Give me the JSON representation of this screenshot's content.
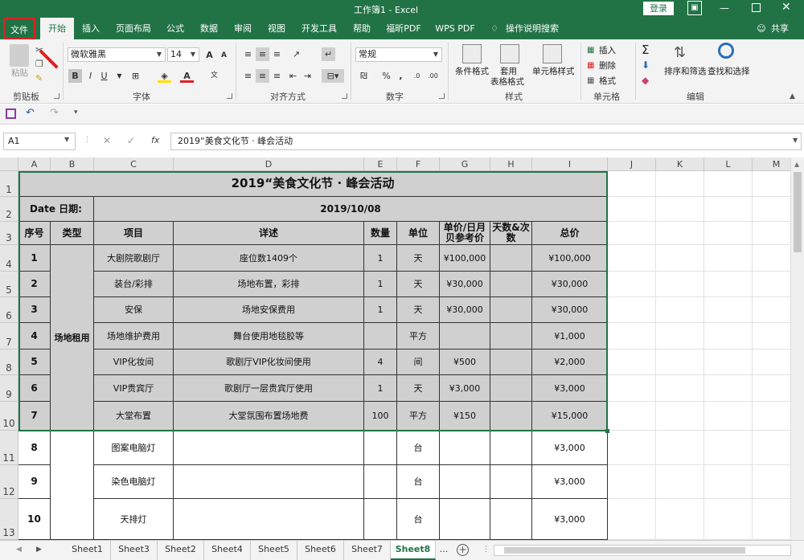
{
  "window": {
    "title": "工作簿1 - Excel",
    "login": "登录"
  },
  "tabs": [
    "文件",
    "开始",
    "插入",
    "页面布局",
    "公式",
    "数据",
    "审阅",
    "视图",
    "开发工具",
    "帮助",
    "福昕PDF",
    "WPS PDF",
    "操作说明搜索"
  ],
  "share": "共享",
  "ribbon": {
    "clipboard": {
      "label": "剪贴板",
      "paste": "粘贴"
    },
    "font": {
      "label": "字体",
      "name": "微软雅黑",
      "size": "14",
      "grow": "A",
      "shrink": "A",
      "bold": "B",
      "italic": "I",
      "underline": "U"
    },
    "alignment": {
      "label": "对齐方式"
    },
    "number": {
      "label": "数字",
      "format": "常规",
      "percent": "%",
      "comma": ","
    },
    "styles": {
      "label": "样式",
      "conditional": "条件格式",
      "table_line1": "套用",
      "table_line2": "表格格式",
      "cell_styles": "单元格样式"
    },
    "cells": {
      "label": "单元格",
      "insert": "插入",
      "delete": "删除",
      "format": "格式"
    },
    "editing": {
      "label": "编辑",
      "sort": "排序和筛选",
      "find": "查找和选择"
    }
  },
  "formula": {
    "namebox": "A1",
    "fx": "fx",
    "content": "2019“美食文化节 · 峰会活动"
  },
  "columns": [
    "A",
    "B",
    "C",
    "D",
    "E",
    "F",
    "G",
    "H",
    "I",
    "J",
    "K",
    "L",
    "M"
  ],
  "rows": [
    "1",
    "2",
    "3",
    "4",
    "5",
    "6",
    "7",
    "8",
    "9",
    "10",
    "11",
    "12",
    "13"
  ],
  "sheet": {
    "title": "2019“美食文化节 · 峰会活动",
    "date_label": "Date    日期:",
    "date_value": "2019/10/08",
    "headers": [
      "序号",
      "类型",
      "项目",
      "详述",
      "数量",
      "单位",
      "单价/日月贝参考价",
      "天数&次数",
      "总价"
    ],
    "category": "场地租用",
    "items": [
      {
        "no": "1",
        "item": "大剧院歌剧厅",
        "detail": "座位数1409个",
        "qty": "1",
        "unit": "天",
        "price": "¥100,000",
        "days": "",
        "total": "¥100,000"
      },
      {
        "no": "2",
        "item": "装台/彩排",
        "detail": "场地布置，彩排",
        "qty": "1",
        "unit": "天",
        "price": "¥30,000",
        "days": "",
        "total": "¥30,000"
      },
      {
        "no": "3",
        "item": "安保",
        "detail": "场地安保费用",
        "qty": "1",
        "unit": "天",
        "price": "¥30,000",
        "days": "",
        "total": "¥30,000"
      },
      {
        "no": "4",
        "item": "场地维护费用",
        "detail": "舞台使用地毯胶等",
        "qty": "",
        "unit": "平方",
        "price": "",
        "days": "",
        "total": "¥1,000"
      },
      {
        "no": "5",
        "item": "VIP化妆间",
        "detail": "歌剧厅VIP化妆间使用",
        "qty": "4",
        "unit": "间",
        "price": "¥500",
        "days": "",
        "total": "¥2,000"
      },
      {
        "no": "6",
        "item": "VIP贵宾厅",
        "detail": "歌剧厅一层贵宾厅使用",
        "qty": "1",
        "unit": "天",
        "price": "¥3,000",
        "days": "",
        "total": "¥3,000"
      },
      {
        "no": "7",
        "item": "大堂布置",
        "detail": "大堂氛围布置场地费",
        "qty": "100",
        "unit": "平方",
        "price": "¥150",
        "days": "",
        "total": "¥15,000"
      },
      {
        "no": "8",
        "item": "图案电脑灯",
        "detail": "",
        "qty": "",
        "unit": "台",
        "price": "",
        "days": "",
        "total": "¥3,000"
      },
      {
        "no": "9",
        "item": "染色电脑灯",
        "detail": "",
        "qty": "",
        "unit": "台",
        "price": "",
        "days": "",
        "total": "¥3,000"
      },
      {
        "no": "10",
        "item": "天排灯",
        "detail": "",
        "qty": "",
        "unit": "台",
        "price": "",
        "days": "",
        "total": "¥3,000"
      }
    ]
  },
  "sheet_tabs": [
    "Sheet1",
    "Sheet3",
    "Sheet2",
    "Sheet4",
    "Sheet5",
    "Sheet6",
    "Sheet7",
    "Sheet8"
  ],
  "more_tabs": "...",
  "colors": {
    "accent": "#217346",
    "highlight": "#e02020",
    "gray_fill": "#d0d0d0"
  }
}
